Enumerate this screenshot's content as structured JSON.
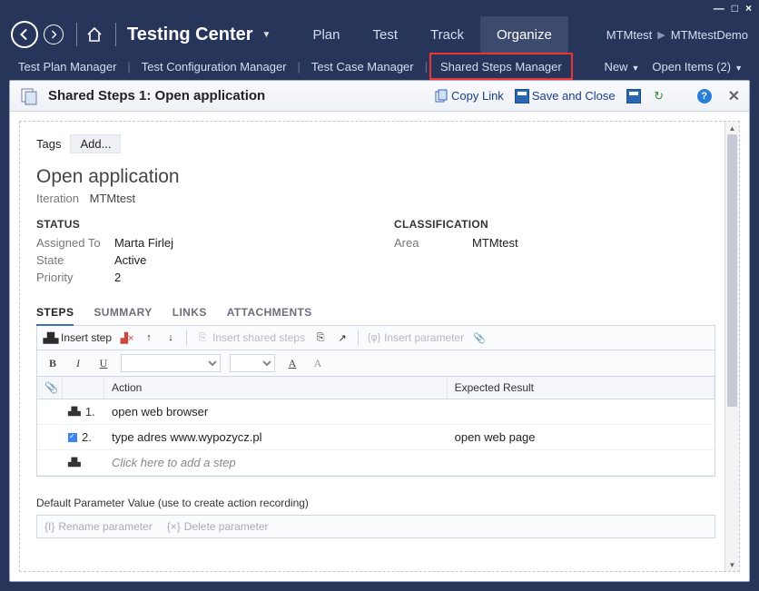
{
  "window_controls": {
    "min": "—",
    "max": "□",
    "close": "×"
  },
  "app": {
    "title": "Testing Center"
  },
  "header": {
    "tabs": [
      {
        "label": "Plan"
      },
      {
        "label": "Test"
      },
      {
        "label": "Track"
      },
      {
        "label": "Organize",
        "active": true
      }
    ],
    "breadcrumb": {
      "project": "MTMtest",
      "item": "MTMtestDemo"
    }
  },
  "subnav": {
    "items": [
      {
        "label": "Test Plan Manager"
      },
      {
        "label": "Test Configuration Manager"
      },
      {
        "label": "Test Case Manager"
      },
      {
        "label": "Shared Steps Manager",
        "highlight": true
      }
    ],
    "new": "New",
    "open_items": "Open Items (2)"
  },
  "card": {
    "title": "Shared Steps 1: Open application",
    "copy_link": "Copy Link",
    "save_close": "Save and Close"
  },
  "tags": {
    "label": "Tags",
    "add": "Add..."
  },
  "workitem": {
    "title": "Open application",
    "iteration_label": "Iteration",
    "iteration_value": "MTMtest"
  },
  "status": {
    "heading": "STATUS",
    "assigned_to_label": "Assigned To",
    "assigned_to": "Marta Firlej",
    "state_label": "State",
    "state": "Active",
    "priority_label": "Priority",
    "priority": "2"
  },
  "classification": {
    "heading": "CLASSIFICATION",
    "area_label": "Area",
    "area": "MTMtest"
  },
  "inner_tabs": [
    {
      "label": "STEPS",
      "active": true
    },
    {
      "label": "SUMMARY"
    },
    {
      "label": "LINKS"
    },
    {
      "label": "ATTACHMENTS"
    }
  ],
  "steps_toolbar": {
    "insert_step": "Insert step",
    "insert_shared": "Insert shared steps",
    "insert_param": "Insert parameter"
  },
  "steps_table": {
    "col_action": "Action",
    "col_result": "Expected Result",
    "rows": [
      {
        "num": "1.",
        "action": "open web browser",
        "result": ""
      },
      {
        "num": "2.",
        "action": "type adres www.wypozycz.pl",
        "result": "open web page"
      }
    ],
    "placeholder": "Click here to add a step"
  },
  "params": {
    "heading": "Default Parameter Value (use to create action recording)",
    "rename": "Rename parameter",
    "delete": "Delete parameter"
  }
}
